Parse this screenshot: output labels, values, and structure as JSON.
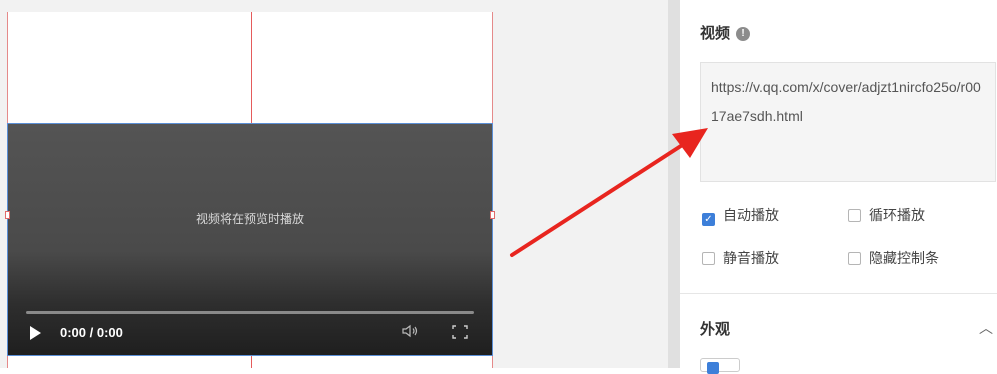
{
  "canvas": {
    "video_message": "视频将在预览时播放",
    "time": "0:00 / 0:00"
  },
  "panel": {
    "video_section_title": "视频",
    "info_icon": "!",
    "video_url": "https://v.qq.com/x/cover/adjzt1nircfo25o/r0017ae7sdh.html",
    "options": [
      {
        "label": "自动播放",
        "checked": true
      },
      {
        "label": "循环播放",
        "checked": false
      },
      {
        "label": "静音播放",
        "checked": false
      },
      {
        "label": "隐藏控制条",
        "checked": false
      }
    ],
    "appearance_title": "外观",
    "chevron": "︿"
  },
  "colors": {
    "accent": "#3d7fd9",
    "selection_border": "#5b8fd6",
    "guide_line": "#e55b5b",
    "annotation_arrow": "#e8251f"
  },
  "icons": [
    "play-icon",
    "volume-icon",
    "fullscreen-icon",
    "info-icon",
    "chevron-up-icon",
    "check-icon"
  ]
}
